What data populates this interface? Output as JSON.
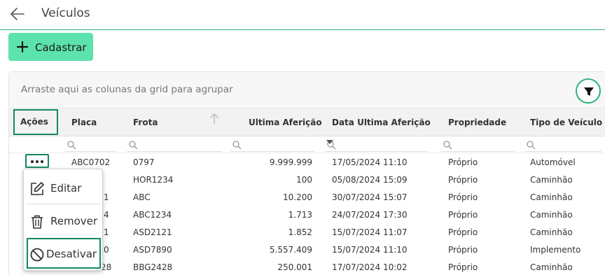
{
  "header": {
    "title": "Veículos"
  },
  "toolbar": {
    "add_label": "Cadastrar"
  },
  "grid": {
    "group_panel_text": "Arraste aqui as colunas da grid para agrupar",
    "columns": [
      "Ações",
      "Placa",
      "Frota",
      "Ultima Aferição",
      "Data Ultima Aferição",
      "Propriedade",
      "Tipo de Veículo"
    ],
    "rows": [
      {
        "placa": "ABC0702",
        "frota": "0797",
        "ultima": "9.999.999",
        "data": "17/05/2024 11:10",
        "prop": "Próprio",
        "tipo": "Automóvel"
      },
      {
        "placa": "",
        "frota": "HOR1234",
        "ultima": "100",
        "data": "05/08/2024 15:09",
        "prop": "Próprio",
        "tipo": "Caminhão"
      },
      {
        "placa": "1",
        "frota": "ABC",
        "ultima": "10.200",
        "data": "30/07/2024 15:07",
        "prop": "Próprio",
        "tipo": "Caminhão"
      },
      {
        "placa": "4",
        "frota": "ABC1234",
        "ultima": "1.713",
        "data": "24/07/2024 17:30",
        "prop": "Próprio",
        "tipo": "Caminhão"
      },
      {
        "placa": "1",
        "frota": "ASD2121",
        "ultima": "1.852",
        "data": "15/07/2024 11:07",
        "prop": "Próprio",
        "tipo": "Caminhão"
      },
      {
        "placa": "0",
        "frota": "ASD7890",
        "ultima": "5.557.409",
        "data": "15/07/2024 11:10",
        "prop": "Próprio",
        "tipo": "Implemento"
      },
      {
        "placa": "28",
        "frota": "BBG2428",
        "ultima": "250.001",
        "data": "17/07/2024 10:02",
        "prop": "Próprio",
        "tipo": "Caminhão"
      }
    ]
  },
  "menu": {
    "items": [
      {
        "label": "Editar",
        "icon": "edit-icon"
      },
      {
        "label": "Remover",
        "icon": "trash-icon"
      },
      {
        "label": "Desativar",
        "icon": "block-icon"
      }
    ]
  },
  "colors": {
    "accent": "#5ce3ad",
    "border_accent": "#148a5a",
    "line": "#2bb37a"
  }
}
